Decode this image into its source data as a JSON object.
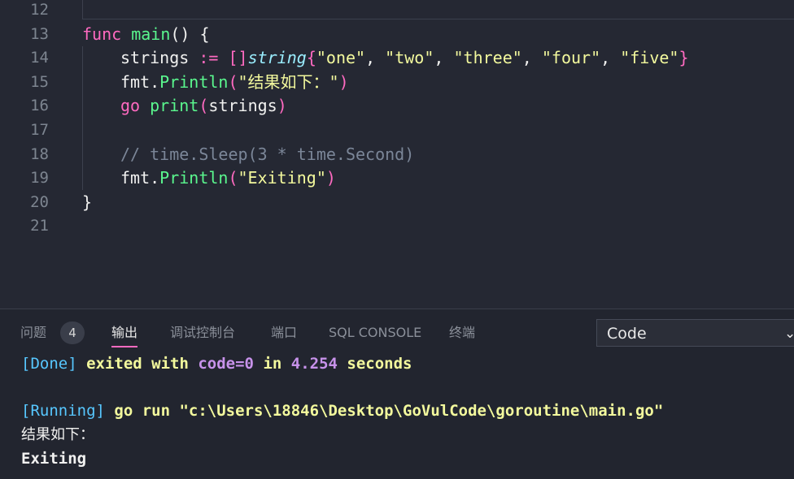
{
  "editor": {
    "line_numbers": [
      "12",
      "13",
      "14",
      "15",
      "16",
      "17",
      "18",
      "19",
      "20",
      "21"
    ],
    "l13": {
      "kw": "func",
      "name": "main",
      "rest": "() {"
    },
    "l14": {
      "var": "strings",
      "op": " := ",
      "brackets": "[]",
      "type": "string",
      "open": "{",
      "s1": "\"one\"",
      "c1": ", ",
      "s2": "\"two\"",
      "c2": ", ",
      "s3": "\"three\"",
      "c3": ", ",
      "s4": "\"four\"",
      "c4": ", ",
      "s5": "\"five\"",
      "close": "}"
    },
    "l15": {
      "pkg": "fmt.",
      "fn": "Println",
      "open": "(",
      "str": "\"结果如下：\"",
      "close": ")"
    },
    "l16": {
      "kw": "go",
      "fn": "print",
      "open": "(",
      "arg": "strings",
      "close": ")"
    },
    "l18": {
      "comment": "// time.Sleep(3 * time.Second)"
    },
    "l19": {
      "pkg": "fmt.",
      "fn": "Println",
      "open": "(",
      "str": "\"Exiting\"",
      "close": ")"
    },
    "l20": {
      "brace": "}"
    }
  },
  "panel": {
    "tabs": {
      "problems": "问题",
      "problems_count": "4",
      "output": "输出",
      "debug_console": "调试控制台",
      "ports": "端口",
      "sql_console": "SQL CONSOLE",
      "terminal": "终端"
    },
    "output_select": "Code",
    "output": {
      "line1": {
        "tag": "[Done]",
        "text1": " exited with ",
        "code": "code=0",
        "text2": " in ",
        "time": "4.254",
        "text3": " seconds"
      },
      "line2": {
        "tag": "[Running]",
        "cmd": " go run \"c:\\Users\\18846\\Desktop\\GoVulCode\\goroutine\\main.go\""
      },
      "line3": "结果如下：",
      "line4": "Exiting"
    }
  },
  "colors": {
    "accent": "#ff6ac1",
    "background": "#22252f"
  }
}
